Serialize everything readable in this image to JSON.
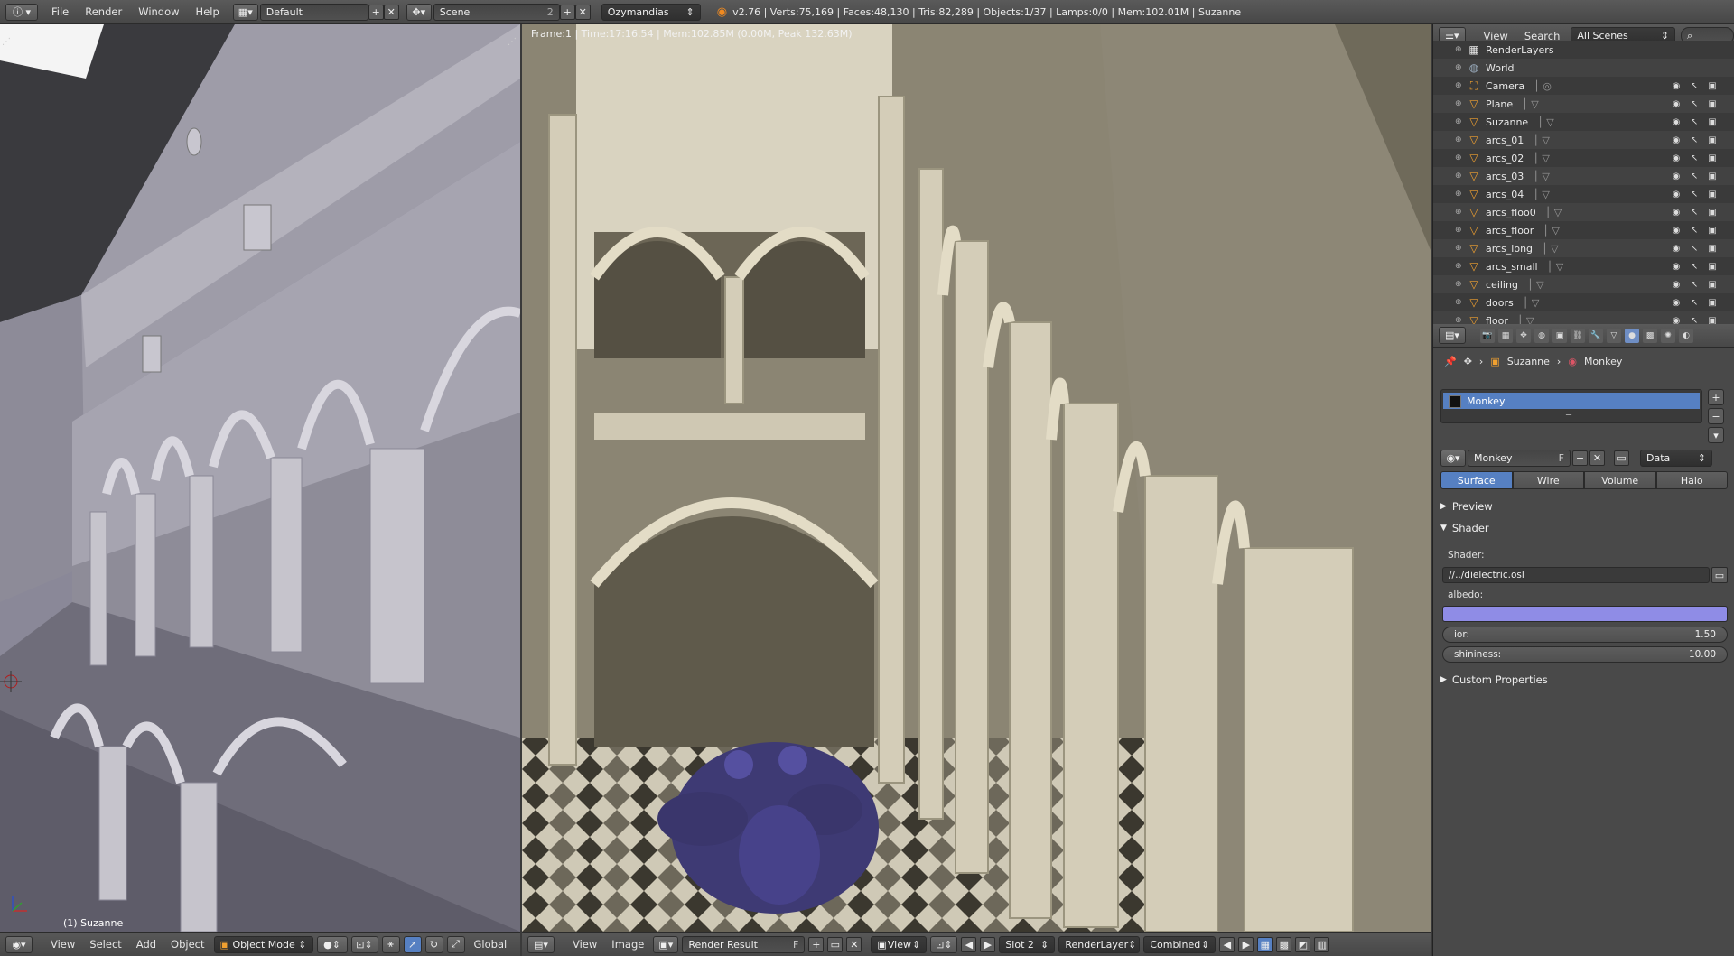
{
  "topbar": {
    "menus": [
      "File",
      "Render",
      "Window",
      "Help"
    ],
    "screen_layout": "Default",
    "scene": "Scene",
    "scene_users": "2",
    "render_engine": "Ozymandias",
    "stats": "v2.76 | Verts:75,169 | Faces:48,130 | Tris:82,289 | Objects:1/37 | Lamps:0/0 | Mem:102.01M | Suzanne"
  },
  "viewport3d": {
    "object_label": "(1) Suzanne",
    "header": {
      "view": "View",
      "select": "Select",
      "add": "Add",
      "object": "Object",
      "mode": "Object Mode",
      "orientation": "Global"
    }
  },
  "render": {
    "info": "Frame:1 | Time:17:16.54 | Mem:102.85M (0.00M, Peak 132.63M)",
    "header": {
      "view": "View",
      "image": "Image",
      "image_name": "Render Result",
      "fake": "F",
      "view_dropdown": "View",
      "slot": "Slot 2",
      "layer": "RenderLayer",
      "pass": "Combined"
    }
  },
  "outliner": {
    "view": "View",
    "search": "Search",
    "filter": "All Scenes",
    "items": [
      {
        "name": "RenderLayers",
        "icon": "renderlayers-icon"
      },
      {
        "name": "World",
        "icon": "world-icon"
      },
      {
        "name": "Camera",
        "icon": "camera-icon"
      },
      {
        "name": "Plane",
        "icon": "mesh-icon"
      },
      {
        "name": "Suzanne",
        "icon": "mesh-icon"
      },
      {
        "name": "arcs_01",
        "icon": "mesh-icon"
      },
      {
        "name": "arcs_02",
        "icon": "mesh-icon"
      },
      {
        "name": "arcs_03",
        "icon": "mesh-icon"
      },
      {
        "name": "arcs_04",
        "icon": "mesh-icon"
      },
      {
        "name": "arcs_floo0",
        "icon": "mesh-icon"
      },
      {
        "name": "arcs_floor",
        "icon": "mesh-icon"
      },
      {
        "name": "arcs_long",
        "icon": "mesh-icon"
      },
      {
        "name": "arcs_small",
        "icon": "mesh-icon"
      },
      {
        "name": "ceiling",
        "icon": "mesh-icon"
      },
      {
        "name": "doors",
        "icon": "mesh-icon"
      },
      {
        "name": "floor",
        "icon": "mesh-icon"
      }
    ]
  },
  "properties": {
    "breadcrumb_object": "Suzanne",
    "breadcrumb_material": "Monkey",
    "material_slot": "Monkey",
    "material_name": "Monkey",
    "fake_user": "F",
    "link": "Data",
    "tabs": [
      "Surface",
      "Wire",
      "Volume",
      "Halo"
    ],
    "preview_label": "Preview",
    "shader_label": "Shader",
    "shader_field_label": "Shader:",
    "shader_path": "//../dielectric.osl",
    "albedo_label": "albedo:",
    "albedo_color": "#8f8ce6",
    "ior_label": "ior:",
    "ior_value": "1.50",
    "shininess_label": "shininess:",
    "shininess_value": "10.00",
    "custom_props_label": "Custom Properties"
  }
}
